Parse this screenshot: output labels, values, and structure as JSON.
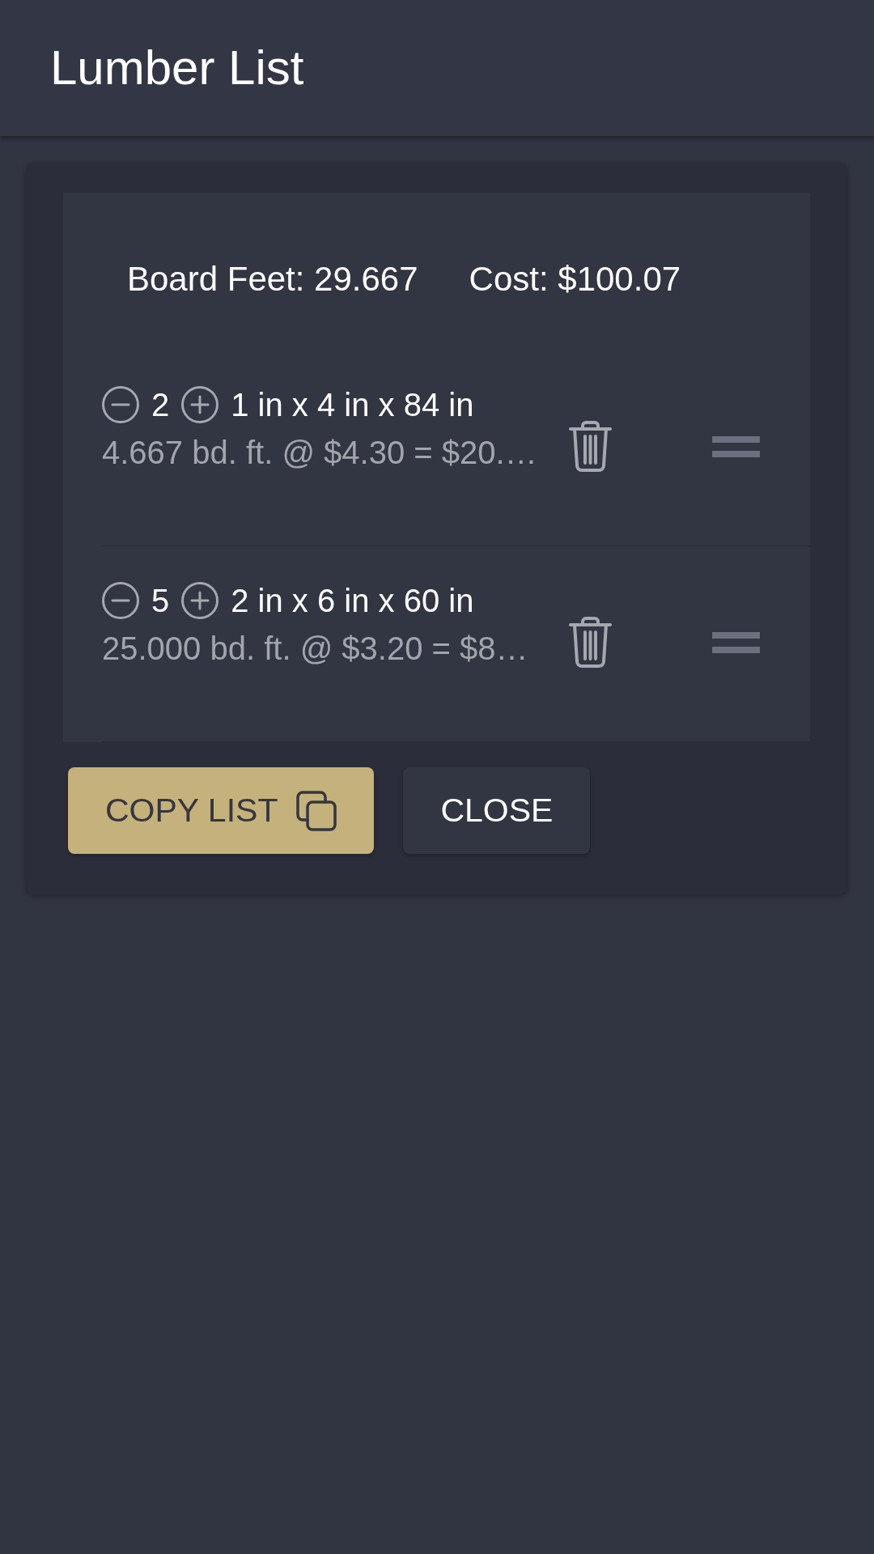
{
  "header": {
    "title": "Lumber List"
  },
  "summary": {
    "board_feet": "Board Feet: 29.667",
    "cost": "Cost: $100.07"
  },
  "items": [
    {
      "quantity": "2",
      "dimensions": "1 in x 4 in x 84 in",
      "detail": "4.667 bd. ft. @ $4.30 = $20.…"
    },
    {
      "quantity": "5",
      "dimensions": "2 in x 6 in x 60 in",
      "detail": "25.000 bd. ft. @ $3.20 = $8…"
    }
  ],
  "buttons": [
    {
      "label": "COPY LIST",
      "kind": "primary"
    },
    {
      "label": "CLOSE",
      "kind": "secondary"
    }
  ]
}
